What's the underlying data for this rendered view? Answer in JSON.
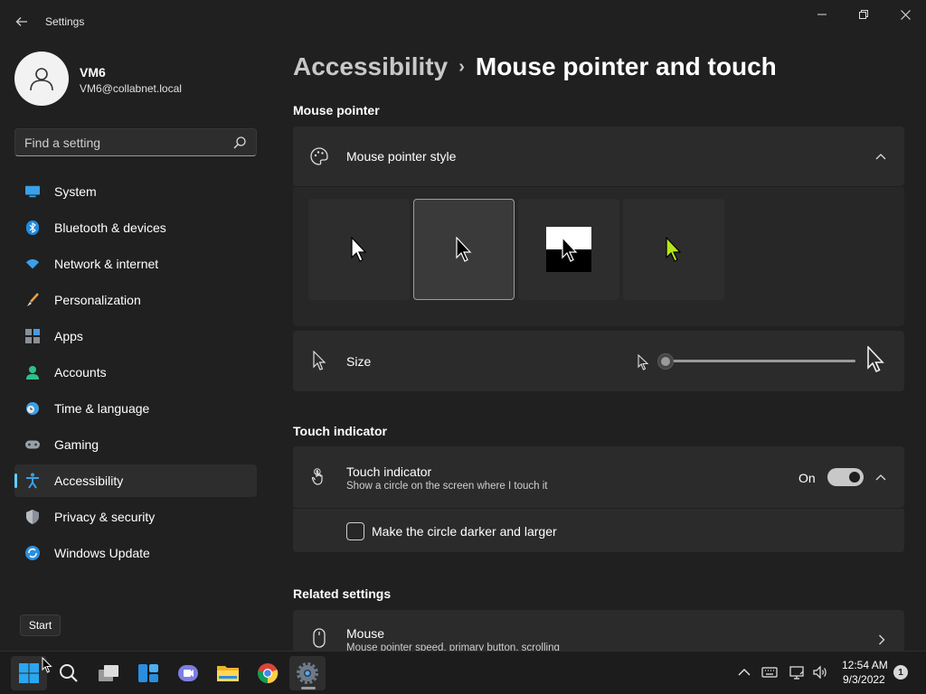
{
  "window": {
    "app_title": "Settings",
    "icons": {
      "back": "back-arrow-icon",
      "minimize": "minimize-icon",
      "maximize": "restore-icon",
      "close": "close-icon"
    }
  },
  "profile": {
    "name": "VM6",
    "email": "VM6@collabnet.local"
  },
  "search": {
    "placeholder": "Find a setting"
  },
  "sidebar": {
    "items": [
      {
        "label": "System",
        "icon": "system-icon",
        "selected": false
      },
      {
        "label": "Bluetooth & devices",
        "icon": "bluetooth-icon",
        "selected": false
      },
      {
        "label": "Network & internet",
        "icon": "wifi-icon",
        "selected": false
      },
      {
        "label": "Personalization",
        "icon": "brush-icon",
        "selected": false
      },
      {
        "label": "Apps",
        "icon": "apps-icon",
        "selected": false
      },
      {
        "label": "Accounts",
        "icon": "accounts-icon",
        "selected": false
      },
      {
        "label": "Time & language",
        "icon": "clock-globe-icon",
        "selected": false
      },
      {
        "label": "Gaming",
        "icon": "gamepad-icon",
        "selected": false
      },
      {
        "label": "Accessibility",
        "icon": "accessibility-icon",
        "selected": true
      },
      {
        "label": "Privacy & security",
        "icon": "shield-icon",
        "selected": false
      },
      {
        "label": "Windows Update",
        "icon": "update-icon",
        "selected": false
      }
    ]
  },
  "main": {
    "breadcrumb": {
      "parent": "Accessibility",
      "separator": "›",
      "current": "Mouse pointer and touch"
    },
    "mouse_pointer": {
      "section_title": "Mouse pointer",
      "style_label": "Mouse pointer style",
      "style_options": [
        {
          "name": "white",
          "selected": false
        },
        {
          "name": "black",
          "selected": true
        },
        {
          "name": "inverted",
          "selected": false
        },
        {
          "name": "custom",
          "selected": false,
          "color": "#b4e61a"
        }
      ],
      "size_label": "Size",
      "size_value": 1
    },
    "touch": {
      "section_title": "Touch indicator",
      "indicator_label": "Touch indicator",
      "indicator_desc": "Show a circle on the screen where I touch it",
      "toggle_state": "On",
      "toggle_on": true,
      "darker_label": "Make the circle darker and larger",
      "darker_checked": false
    },
    "related": {
      "section_title": "Related settings",
      "mouse_label": "Mouse",
      "mouse_desc": "Mouse pointer speed, primary button, scrolling"
    }
  },
  "tooltip": {
    "text": "Start"
  },
  "taskbar": {
    "apps": [
      "start-icon",
      "search-icon",
      "task-view-icon",
      "widgets-icon",
      "teams-chat-icon",
      "file-explorer-icon",
      "chrome-icon",
      "settings-icon"
    ],
    "clock_time": "12:54 AM",
    "clock_date": "9/3/2022",
    "notification_count": "1"
  },
  "colors": {
    "accent": "#60cdff",
    "background": "#202020",
    "card": "#2b2b2b",
    "custom_pointer": "#b4e61a"
  }
}
